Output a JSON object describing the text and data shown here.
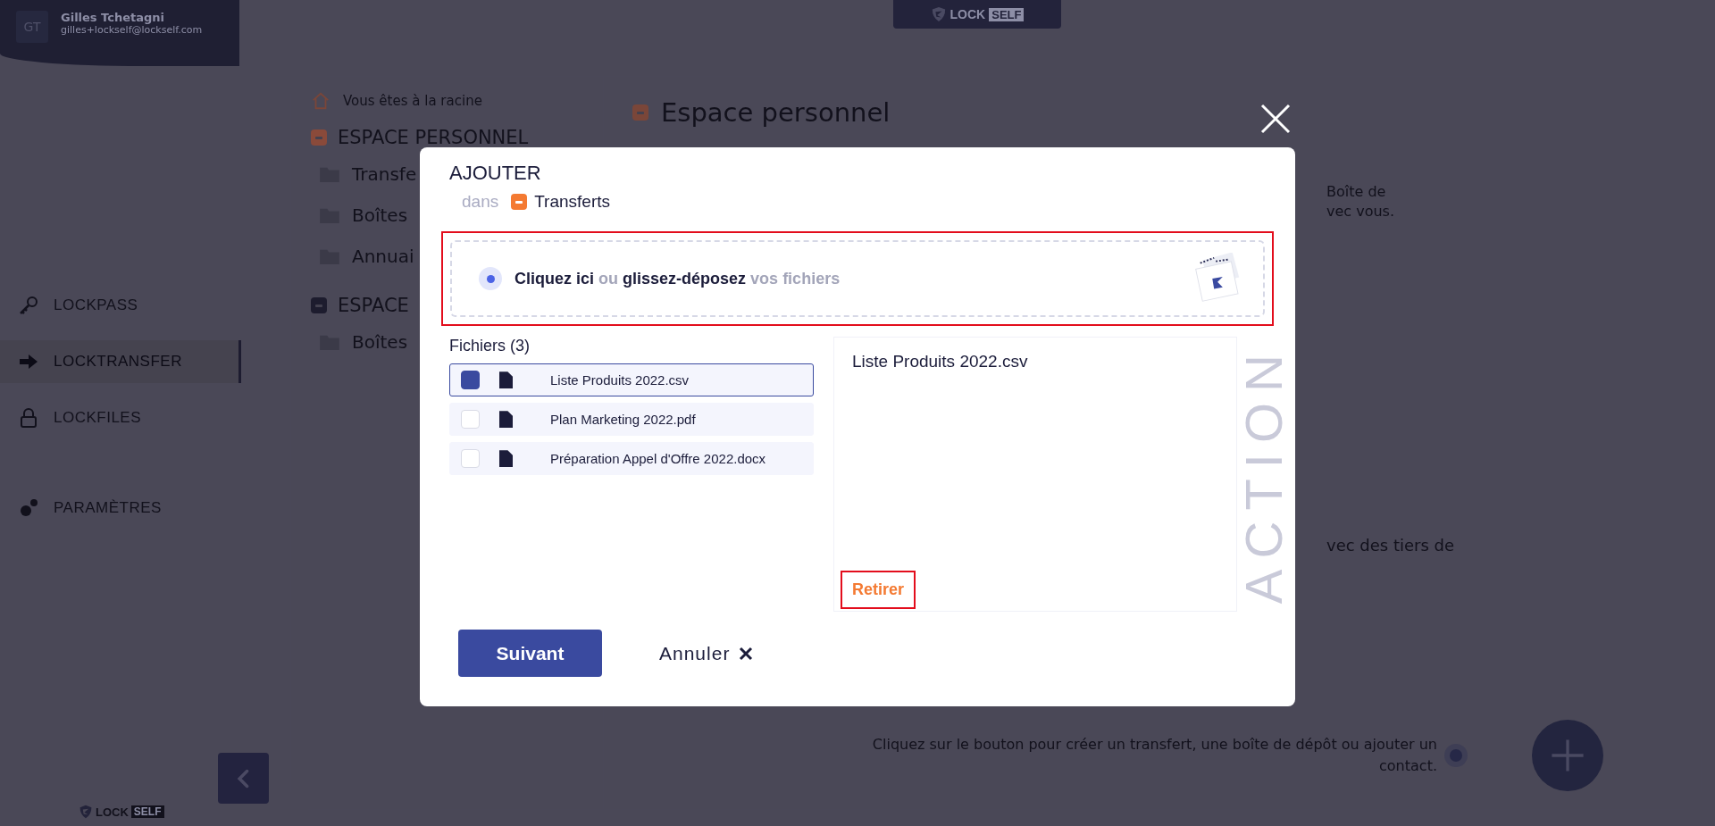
{
  "user": {
    "initials": "GT",
    "name": "Gilles Tchetagni",
    "email": "gilles+lockself@lockself.com"
  },
  "top_logo": {
    "word": "LOCK",
    "tag": "SELF"
  },
  "nav": [
    {
      "label": "LOCKPASS",
      "selected": false
    },
    {
      "label": "LOCKTRANSFER",
      "selected": true
    },
    {
      "label": "LOCKFILES",
      "selected": false
    },
    {
      "label": "PARAMÈTRES",
      "selected": false
    }
  ],
  "bottom_logo": {
    "word": "LOCK",
    "tag": "SELF"
  },
  "breadcrumb": "Vous êtes à la racine",
  "tree": [
    {
      "label": "ESPACE PERSONNEL",
      "color": "#8a4a3a",
      "children": [
        {
          "label": "Transfe"
        },
        {
          "label": "Boîtes"
        },
        {
          "label": "Annuai"
        }
      ]
    },
    {
      "label": "ESPACE",
      "color": "#1d1c2e",
      "children": [
        {
          "label": "Boîtes"
        }
      ]
    }
  ],
  "content": {
    "title": "Espace personnel",
    "fragments_top": [
      "Boîte de",
      "vec vous."
    ],
    "fragment_mid": "vec des tiers de",
    "hint": "Cliquez sur le bouton pour créer un transfert, une boîte de dépôt ou ajouter un contact."
  },
  "modal": {
    "title": "AJOUTER",
    "location_prefix": "dans",
    "location": "Transferts",
    "side_text": "ACTION",
    "dropzone": {
      "highlighted": true,
      "parts": [
        {
          "text": "Cliquez ici",
          "emphasis": true
        },
        {
          "text": "ou",
          "emphasis": false
        },
        {
          "text": "glissez-déposez",
          "emphasis": true
        },
        {
          "text": "vos fichiers",
          "emphasis": false
        }
      ]
    },
    "files_heading": "Fichiers (3)",
    "files": [
      {
        "name": "Liste Produits 2022.csv",
        "selected": true
      },
      {
        "name": "Plan Marketing 2022.pdf",
        "selected": false
      },
      {
        "name": "Préparation Appel d'Offre 2022.docx",
        "selected": false
      }
    ],
    "preview": {
      "name": "Liste Produits 2022.csv"
    },
    "remove": {
      "label": "Retirer",
      "highlighted": true
    },
    "primary": "Suivant",
    "cancel": "Annuler"
  }
}
